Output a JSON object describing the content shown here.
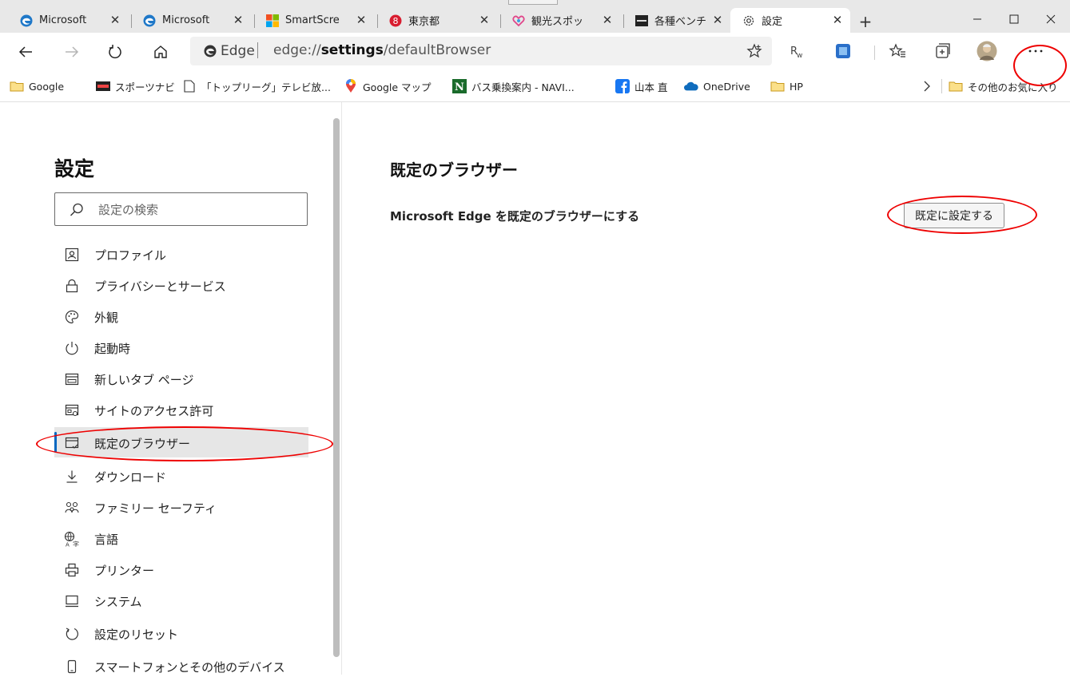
{
  "tabs": [
    {
      "title": "Microsoft",
      "icon": "edge-icon"
    },
    {
      "title": "Microsoft",
      "icon": "edge-icon"
    },
    {
      "title": "SmartScre",
      "icon": "microsoft-logo-icon"
    },
    {
      "title": "東京都",
      "icon": "tokyo-logo-icon"
    },
    {
      "title": "観光スポッ",
      "icon": "heart-logo-icon"
    },
    {
      "title": "各種ベンチ",
      "icon": "benchmark-logo-icon"
    },
    {
      "title": "設定",
      "icon": "gear-icon",
      "active": true
    }
  ],
  "address_bar": {
    "site_name": "Edge",
    "url_prefix": "edge://",
    "url_bold": "settings",
    "url_rest": "/defaultBrowser"
  },
  "favorites": [
    {
      "label": "Google",
      "icon": "folder-icon"
    },
    {
      "label": "スポーツナビ",
      "icon": "sportsnavi-logo-icon"
    },
    {
      "label": "「トップリーグ」テレビ放...",
      "icon": "page-icon"
    },
    {
      "label": "Google マップ",
      "icon": "maps-pin-icon"
    },
    {
      "label": "バス乗換案内 - NAVI...",
      "icon": "navitime-logo-icon"
    },
    {
      "label": "山本 直",
      "icon": "facebook-icon"
    },
    {
      "label": "OneDrive",
      "icon": "onedrive-cloud-icon"
    },
    {
      "label": "HP",
      "icon": "folder-icon"
    }
  ],
  "other_favorites": "その他のお気に入り",
  "settings": {
    "title": "設定",
    "search_placeholder": "設定の検索",
    "nav": [
      {
        "label": "プロファイル",
        "icon": "profile-icon"
      },
      {
        "label": "プライバシーとサービス",
        "icon": "lock-icon"
      },
      {
        "label": "外観",
        "icon": "palette-icon"
      },
      {
        "label": "起動時",
        "icon": "power-icon"
      },
      {
        "label": "新しいタブ ページ",
        "icon": "new-tab-page-icon"
      },
      {
        "label": "サイトのアクセス許可",
        "icon": "site-permissions-icon"
      },
      {
        "label": "既定のブラウザー",
        "icon": "default-browser-icon",
        "selected": true
      },
      {
        "label": "ダウンロード",
        "icon": "download-icon"
      },
      {
        "label": "ファミリー セーフティ",
        "icon": "family-icon"
      },
      {
        "label": "言語",
        "icon": "language-icon"
      },
      {
        "label": "プリンター",
        "icon": "printer-icon"
      },
      {
        "label": "システム",
        "icon": "system-icon"
      },
      {
        "label": "設定のリセット",
        "icon": "reset-icon"
      },
      {
        "label": "スマートフォンとその他のデバイス",
        "icon": "phone-icon"
      }
    ]
  },
  "main": {
    "section_title": "既定のブラウザー",
    "row_label": "Microsoft Edge を既定のブラウザーにする",
    "button_label": "既定に設定する"
  },
  "colors": {
    "accent": "#0067c0",
    "annotation": "#e00000",
    "tabstrip": "#e8e8e8",
    "selected_nav": "#e6e6e6"
  }
}
